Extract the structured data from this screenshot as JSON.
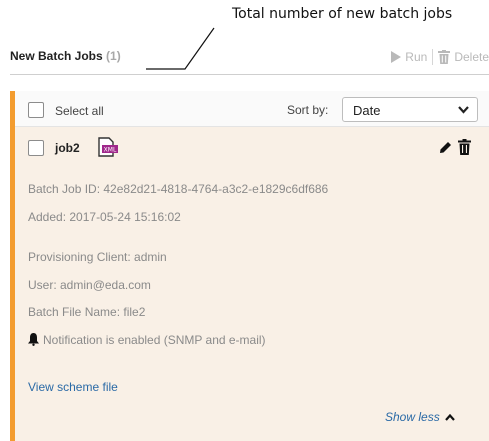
{
  "annotation": {
    "text": "Total number of new batch jobs"
  },
  "panel": {
    "title": "New Batch Jobs",
    "count": "(1)"
  },
  "toolbar": {
    "run_label": "Run",
    "delete_label": "Delete"
  },
  "list_header": {
    "select_all_label": "Select all",
    "sort_by_label": "Sort by:",
    "sort_value": "Date"
  },
  "job": {
    "name": "job2",
    "file_type_badge": "XML",
    "batch_job_id": "Batch Job ID: 42e82d21-4818-4764-a3c2-e1829c6df686",
    "added": "Added: 2017-05-24 15:16:02",
    "provisioning_client": "Provisioning Client: admin",
    "user": "User: admin@eda.com",
    "batch_file_name": "Batch File Name: file2",
    "notification": "Notification is enabled (SNMP and e-mail)",
    "view_scheme_label": "View scheme file",
    "show_less_label": "Show less"
  },
  "colors": {
    "accent_stripe": "#f39c2f",
    "link": "#2b6aa6",
    "card_bg": "#f9f0e6",
    "xml_badge": "#a0288c"
  },
  "icons": [
    "play-icon",
    "trash-icon",
    "chevron-down-icon",
    "xml-file-icon",
    "pencil-icon",
    "bell-icon",
    "chevron-up-icon"
  ]
}
